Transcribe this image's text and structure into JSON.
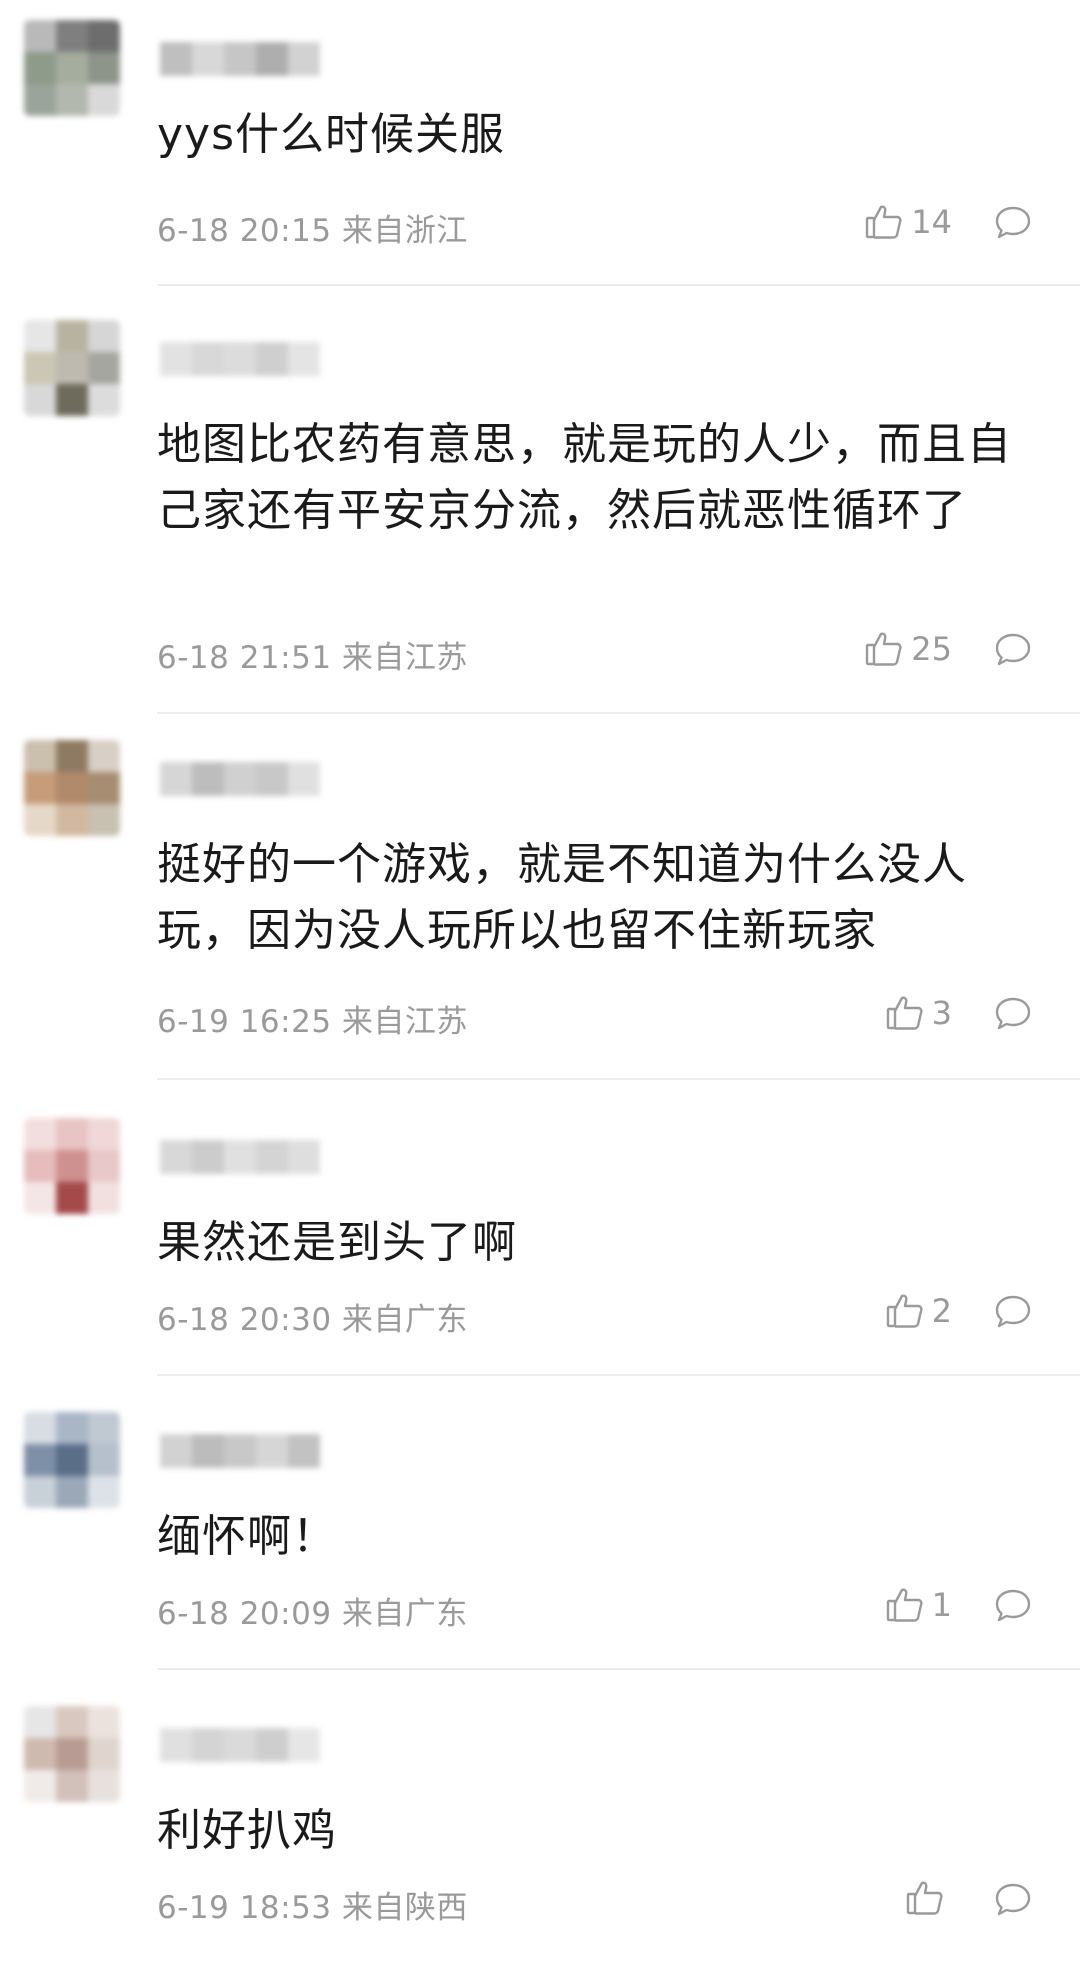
{
  "comments": [
    {
      "text": "yys什么时候关服",
      "time": "6-18 20:15",
      "location": "来自浙江",
      "likes": "14",
      "avatar_colors": [
        "#b9b9b9",
        "#7f7f7f",
        "#6d6d6d",
        "#8e9a8a",
        "#a5ad9e",
        "#8d948a",
        "#9aa49a",
        "#b3b8ae",
        "#d9d9d9"
      ],
      "name_colors": [
        "#bfbfbf",
        "#d8d8d8",
        "#c6c6c6",
        "#aeaeae",
        "#d2d2d2"
      ]
    },
    {
      "text": "地图比农药有意思，就是玩的人少，而且自己家还有平安京分流，然后就恶性循环了",
      "time": "6-18 21:51",
      "location": "来自江苏",
      "likes": "25",
      "avatar_colors": [
        "#e6e6e6",
        "#b8b3a0",
        "#d6d6d6",
        "#cbc7b3",
        "#bfbab0",
        "#a6a6a0",
        "#d8d8d8",
        "#6e6a5c",
        "#dcdcdc"
      ],
      "name_colors": [
        "#e2e2e2",
        "#d8d8d8",
        "#dcdcdc",
        "#cfcfcf",
        "#e4e4e4"
      ]
    },
    {
      "text": "挺好的一个游戏，就是不知道为什么没人玩，因为没人玩所以也留不住新玩家",
      "time": "6-19 16:25",
      "location": "来自江苏",
      "likes": "3",
      "avatar_colors": [
        "#cbbfae",
        "#8e7a62",
        "#d8cfc6",
        "#c69c7a",
        "#b08a6a",
        "#a78d72",
        "#e6d8c8",
        "#d2b8a0",
        "#c8c0b0"
      ],
      "name_colors": [
        "#d6d6d6",
        "#bdbdbd",
        "#d0d0d0",
        "#c8c8c8",
        "#e0e0e0"
      ]
    },
    {
      "text": "果然还是到头了啊",
      "time": "6-18 20:30",
      "location": "来自广东",
      "likes": "2",
      "avatar_colors": [
        "#f2dede",
        "#e8c4c4",
        "#f0d8d8",
        "#e6bcbc",
        "#cf9090",
        "#e8c8c8",
        "#f4e6e6",
        "#a44a4a",
        "#f2e0e0"
      ],
      "name_colors": [
        "#d8d8d8",
        "#cccccc",
        "#e0e0e0",
        "#d4d4d4",
        "#dedede"
      ]
    },
    {
      "text": "缅怀啊！",
      "time": "6-18 20:09",
      "location": "来自广东",
      "likes": "1",
      "avatar_colors": [
        "#d8dde4",
        "#a8b6c6",
        "#c0c8d2",
        "#7e90a8",
        "#5a6e88",
        "#b6c0cc",
        "#c8d0d8",
        "#9aa8b8",
        "#dde2e8"
      ],
      "name_colors": [
        "#d2d2d2",
        "#bcbcbc",
        "#c8c8c8",
        "#d6d6d6",
        "#c2c2c2"
      ]
    },
    {
      "text": "利好扒鸡",
      "time": "6-19 18:53",
      "location": "来自陕西",
      "likes": "",
      "avatar_colors": [
        "#e6e6e6",
        "#d9c8c0",
        "#ebe2de",
        "#cfbab0",
        "#b89c94",
        "#e0d4cf",
        "#f0ebe9",
        "#d2c0ba",
        "#e8e0dc"
      ],
      "name_colors": [
        "#e0e0e0",
        "#d4d4d4",
        "#dadada",
        "#cecece",
        "#e6e6e6"
      ]
    }
  ],
  "icons": {
    "like": "thumbs-up-icon",
    "reply": "speech-bubble-icon"
  },
  "colors": {
    "meta_text": "#9a9a9a",
    "body_text": "#1a1a1a",
    "divider": "#ececec"
  }
}
